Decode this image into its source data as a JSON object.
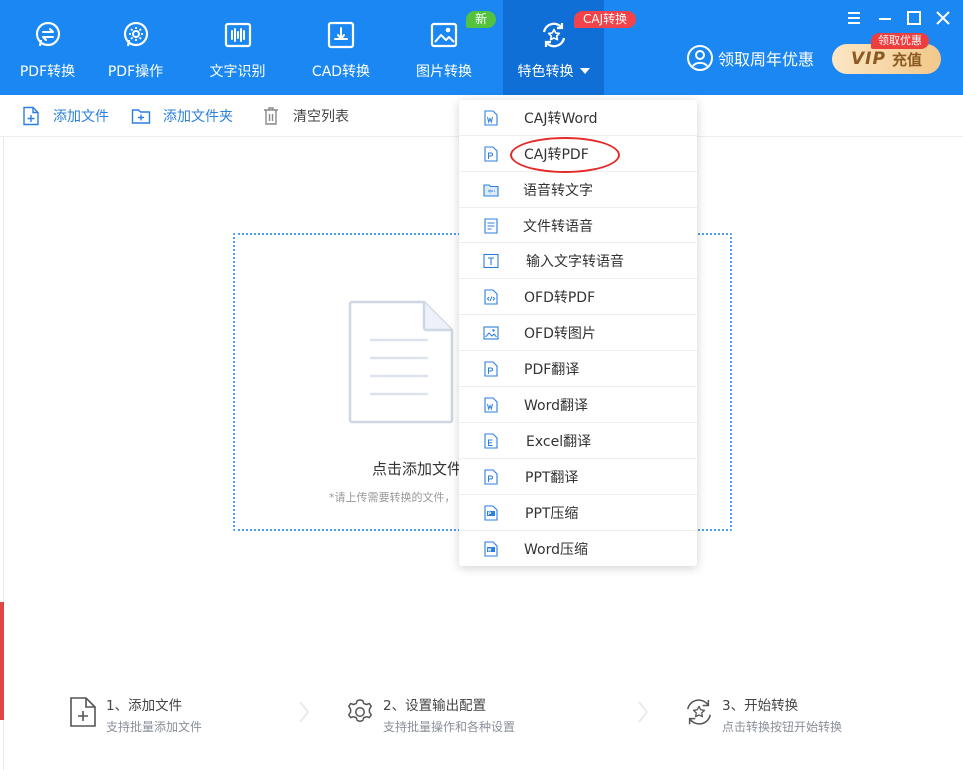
{
  "topnav": {
    "items": [
      {
        "label": "PDF转换",
        "icon": "pdf-convert-icon"
      },
      {
        "label": "PDF操作",
        "icon": "pdf-operate-icon"
      },
      {
        "label": "文字识别",
        "icon": "text-recognition-icon"
      },
      {
        "label": "CAD转换",
        "icon": "cad-convert-icon"
      },
      {
        "label": "图片转换",
        "icon": "image-convert-icon"
      },
      {
        "label": "特色转换",
        "icon": "featured-convert-icon"
      }
    ],
    "badge_new": "新",
    "badge_caj": "CAJ转换"
  },
  "header": {
    "promo_label": "领取周年优惠",
    "vip_label": "VIP",
    "vip_action": "充值",
    "vip_badge": "领取优惠"
  },
  "toolbar": {
    "add_file": "添加文件",
    "add_folder": "添加文件夹",
    "clear_list": "清空列表"
  },
  "dropzone": {
    "title": "点击添加文件",
    "hint": "*请上传需要转换的文件，"
  },
  "steps": [
    {
      "title": "1、添加文件",
      "desc": "支持批量添加文件",
      "icon": "add-file-icon"
    },
    {
      "title": "2、设置输出配置",
      "desc": "支持批量操作和各种设置",
      "icon": "settings-gear-icon"
    },
    {
      "title": "3、开始转换",
      "desc": "点击转换按钮开始转换",
      "icon": "start-convert-icon"
    }
  ],
  "menu": {
    "items": [
      {
        "label": "CAJ转Word",
        "icon": "word-file-icon"
      },
      {
        "label": "CAJ转PDF",
        "icon": "pdf-file-icon"
      },
      {
        "label": "语音转文字",
        "icon": "audio-file-icon"
      },
      {
        "label": "文件转语音",
        "icon": "document-icon"
      },
      {
        "label": "输入文字转语音",
        "icon": "text-input-icon"
      },
      {
        "label": "OFD转PDF",
        "icon": "code-file-icon"
      },
      {
        "label": "OFD转图片",
        "icon": "image-file-icon"
      },
      {
        "label": "PDF翻译",
        "icon": "pdf-file-icon"
      },
      {
        "label": "Word翻译",
        "icon": "word-file-icon"
      },
      {
        "label": "Excel翻译",
        "icon": "excel-file-icon"
      },
      {
        "label": "PPT翻译",
        "icon": "ppt-file-icon"
      },
      {
        "label": "PPT压缩",
        "icon": "ppt-compress-icon"
      },
      {
        "label": "Word压缩",
        "icon": "word-compress-icon"
      }
    ]
  },
  "colors": {
    "primary": "#1a87f2",
    "active_tab": "#0f6fd6",
    "badge_green": "#52c23f",
    "badge_red": "#f2434a",
    "highlight": "#e52a2a"
  }
}
